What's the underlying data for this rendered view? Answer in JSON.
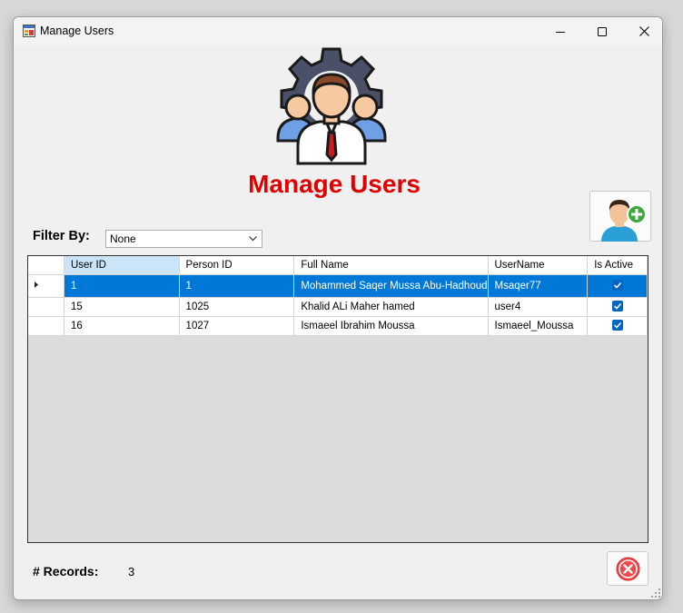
{
  "window": {
    "title": "Manage Users"
  },
  "header": {
    "heading": "Manage Users"
  },
  "filter": {
    "label": "Filter By:",
    "selected": "None"
  },
  "grid": {
    "columns": [
      "User ID",
      "Person ID",
      "Full Name",
      "UserName",
      "Is Active"
    ],
    "rows": [
      {
        "user_id": "1",
        "person_id": "1",
        "full_name": "Mohammed Saqer Mussa Abu-Hadhoud",
        "username": "Msaqer77",
        "is_active": true
      },
      {
        "user_id": "15",
        "person_id": "1025",
        "full_name": "Khalid ALi Maher hamed",
        "username": "user4",
        "is_active": true
      },
      {
        "user_id": "16",
        "person_id": "1027",
        "full_name": "Ismaeel Ibrahim  Moussa",
        "username": "Ismaeel_Moussa",
        "is_active": true
      }
    ]
  },
  "footer": {
    "records_label": "# Records:",
    "records_count": "3"
  },
  "colors": {
    "heading": "#e00000",
    "selection": "#0078d7",
    "checkbox": "#0067c0"
  }
}
